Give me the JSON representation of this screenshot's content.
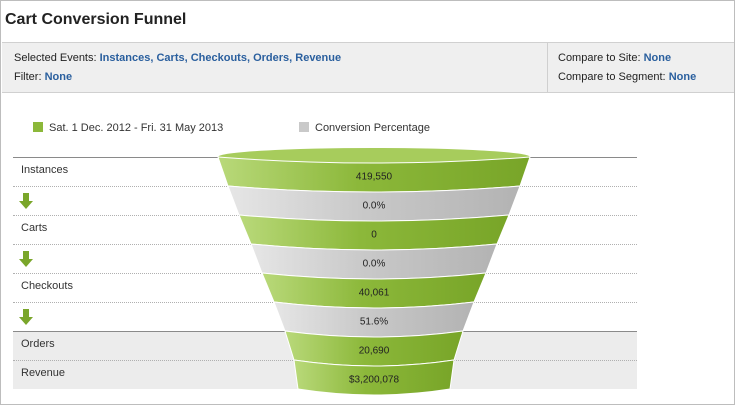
{
  "report": {
    "title": "Cart Conversion Funnel"
  },
  "parameters": {
    "selected_events_label": "Selected Events:",
    "selected_events_value": "Instances, Carts, Checkouts, Orders, Revenue",
    "filter_label": "Filter:",
    "filter_value": "None",
    "compare_site_label": "Compare to Site:",
    "compare_site_value": "None",
    "compare_segment_label": "Compare to Segment:",
    "compare_segment_value": "None"
  },
  "legend": {
    "series_label": "Sat.  1 Dec. 2012 - Fri. 31 May 2013",
    "conversion_label": "Conversion Percentage"
  },
  "colors": {
    "event_fill": "#8cb83a",
    "conversion_fill": "#c9c9c9",
    "accent_link": "#2a5f9e"
  },
  "funnel": {
    "steps": [
      {
        "event": "Instances",
        "value": "419,550",
        "kind": "event"
      },
      {
        "event": "",
        "value": "0.0%",
        "kind": "conversion"
      },
      {
        "event": "Carts",
        "value": "0",
        "kind": "event"
      },
      {
        "event": "",
        "value": "0.0%",
        "kind": "conversion"
      },
      {
        "event": "Checkouts",
        "value": "40,061",
        "kind": "event"
      },
      {
        "event": "",
        "value": "51.6%",
        "kind": "conversion"
      },
      {
        "event": "Orders",
        "value": "20,690",
        "kind": "event"
      },
      {
        "event": "Revenue",
        "value": "$3,200,078",
        "kind": "event"
      }
    ],
    "arrow_icon": "down-arrow-icon"
  }
}
